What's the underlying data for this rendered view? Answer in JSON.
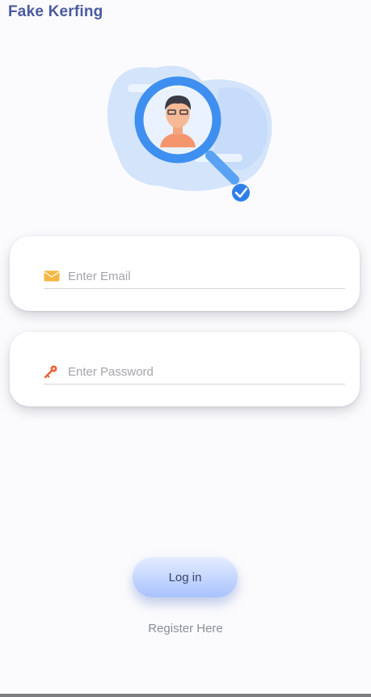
{
  "header": {
    "title": "Fake Kerfing"
  },
  "hero": {
    "icon": "face-search-illustration",
    "colors": {
      "blob": "#cfe2fb",
      "ring": "#3f8ff0",
      "skin": "#f2a783",
      "shirt": "#f4956d",
      "hair": "#3b3b45"
    }
  },
  "login_form": {
    "email": {
      "icon": "email-icon",
      "placeholder": "Enter Email",
      "value": ""
    },
    "password": {
      "icon": "key-icon",
      "placeholder": "Enter Password",
      "value": ""
    },
    "login_label": "Log in",
    "register_label": "Register Here"
  },
  "colors": {
    "accent": "#a9c2ff",
    "title": "#4a5aa0",
    "email_icon": "#f5b642",
    "key_icon": "#e8653a"
  }
}
